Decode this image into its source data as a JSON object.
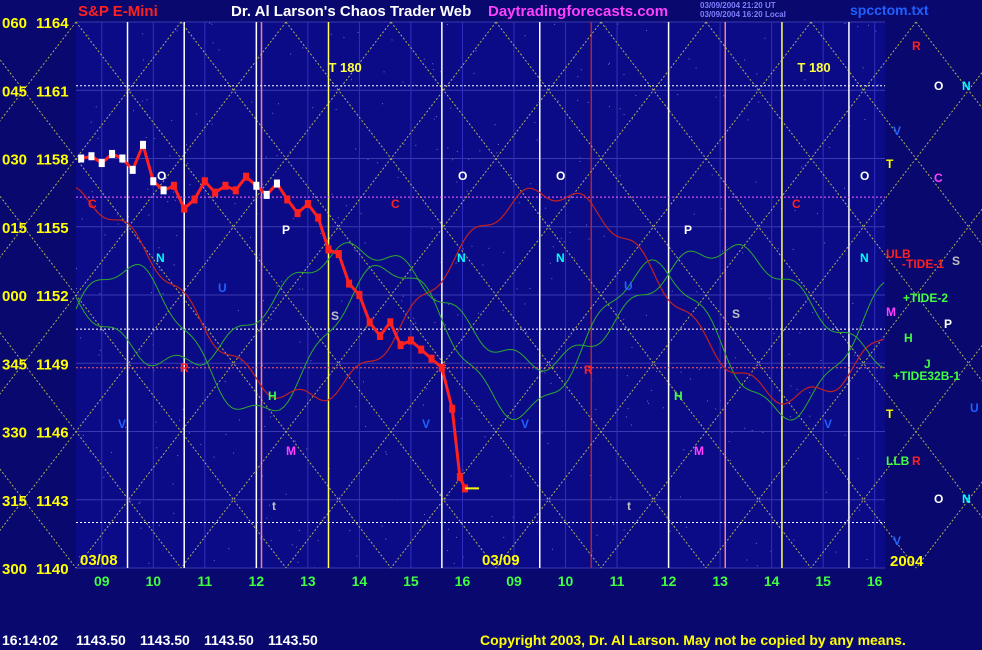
{
  "header": {
    "symbol": "S&P E-Mini",
    "title": "Dr. Al Larson's Chaos Trader Web",
    "site": "Daytradingforecasts.com",
    "stamp1": "03/09/2004 21:20 UT",
    "stamp2": "03/09/2004 16:20 Local",
    "file": "spcctom.txt"
  },
  "status": {
    "time": "16:14:02",
    "quotes": [
      "1143.50",
      "1143.50",
      "1143.50",
      "1143.50"
    ]
  },
  "footer": {
    "copyright": "Copyright 2003, Dr. Al Larson. May not be copied by any means."
  },
  "colors": {
    "background": "#08086e",
    "plot_bg": "#0b0b88",
    "price_red": "#ff2020",
    "price_white": "#ffffff",
    "tide_green": "#2fa82f",
    "tide_red": "#c02020",
    "yellow": "#ffff00",
    "magenta": "#ff40ff",
    "cyan": "#00ffff"
  },
  "chart_data": {
    "type": "line",
    "y_left_labels": [
      "060",
      "045",
      "030",
      "015",
      "000",
      "345",
      "330",
      "315",
      "300"
    ],
    "y_ticks": [
      1164,
      1161,
      1158,
      1155,
      1152,
      1149,
      1146,
      1143,
      1140
    ],
    "ylim": [
      1140,
      1164
    ],
    "x_ticks": [
      "09",
      "10",
      "11",
      "12",
      "13",
      "14",
      "15",
      "16",
      "09",
      "10",
      "11",
      "12",
      "13",
      "14",
      "15",
      "16"
    ],
    "date_labels": [
      "03/08",
      "03/09",
      "2004"
    ],
    "xlim": [
      8.5,
      24.2
    ],
    "grid": true,
    "series": [
      {
        "name": "",
        "color": "#ff2020",
        "x": [
          8.6,
          8.8,
          9.0,
          9.2,
          9.4,
          9.6,
          9.8,
          10.0,
          10.2,
          10.4,
          10.6,
          10.8,
          11.0,
          11.2,
          11.4,
          11.6,
          11.8,
          12.0,
          12.2,
          12.4,
          12.6,
          12.8,
          13.0,
          13.2,
          13.4,
          13.6,
          13.8,
          14.0,
          14.2,
          14.4,
          14.6,
          14.8,
          15.0,
          15.2,
          15.4,
          15.6,
          15.8,
          15.95,
          16.05
        ],
        "values": [
          1158.0,
          1158.1,
          1157.8,
          1158.2,
          1158.0,
          1157.5,
          1158.6,
          1157.0,
          1156.6,
          1156.8,
          1155.8,
          1156.2,
          1157.0,
          1156.5,
          1156.8,
          1156.6,
          1157.2,
          1156.8,
          1156.4,
          1156.9,
          1156.2,
          1155.6,
          1156.0,
          1155.4,
          1154.0,
          1153.8,
          1152.5,
          1152.0,
          1150.8,
          1150.2,
          1150.8,
          1149.8,
          1150.0,
          1149.6,
          1149.2,
          1148.8,
          1147.0,
          1144.0,
          1143.5
        ]
      }
    ],
    "flux_lines": [
      {
        "name": "ULB",
        "color": "#ff2020"
      },
      {
        "name": "-TIDE-1",
        "color": "#ff2020"
      },
      {
        "name": "+TIDE-2",
        "color": "#40ff40"
      },
      {
        "name": "+TIDE32B-1",
        "color": "#40ff40"
      },
      {
        "name": "LLB",
        "color": "#40ff40"
      }
    ],
    "annotations": [
      {
        "text": "T 180",
        "x": 13.4,
        "y": 1161.8
      },
      {
        "text": "T 180",
        "x": 22.5,
        "y": 1161.8
      }
    ]
  },
  "right_legend": {
    "items": [
      {
        "text": "R",
        "color": "#ff2020"
      },
      {
        "text": "O",
        "color": "#ffffff"
      },
      {
        "text": "N",
        "color": "#00ffff"
      },
      {
        "text": "V",
        "color": "#2060ff"
      },
      {
        "text": "T",
        "color": "#ffff00"
      },
      {
        "text": "C",
        "color": "#ff40ff"
      },
      {
        "text": "ULB",
        "color": "#ff2020"
      },
      {
        "text": "-TIDE-1",
        "color": "#ff2020"
      },
      {
        "text": "S",
        "color": "#c0c0c0"
      },
      {
        "text": "+TIDE-2",
        "color": "#40ff40"
      },
      {
        "text": "M",
        "color": "#ff40ff"
      },
      {
        "text": "P",
        "color": "#ffffff"
      },
      {
        "text": "H",
        "color": "#40ff40"
      },
      {
        "text": "J",
        "color": "#40ff40"
      },
      {
        "text": "+TIDE32B-1",
        "color": "#40ff40"
      },
      {
        "text": "T",
        "color": "#ffff00"
      },
      {
        "text": "U",
        "color": "#2060ff"
      },
      {
        "text": "LLB",
        "color": "#40ff40"
      },
      {
        "text": "R",
        "color": "#ff2020"
      },
      {
        "text": "O",
        "color": "#ffffff"
      },
      {
        "text": "N",
        "color": "#00ffff"
      },
      {
        "text": "V",
        "color": "#2060ff"
      }
    ]
  },
  "plot_markers": [
    {
      "text": "O",
      "color": "#ffffff"
    },
    {
      "text": "C",
      "color": "#ff2020"
    },
    {
      "text": "N",
      "color": "#00ffff"
    },
    {
      "text": "P",
      "color": "#ffffff"
    },
    {
      "text": "S",
      "color": "#c0c0c0"
    },
    {
      "text": "H",
      "color": "#40ff40"
    },
    {
      "text": "M",
      "color": "#ff40ff"
    },
    {
      "text": "V",
      "color": "#2060ff"
    },
    {
      "text": "U",
      "color": "#2060ff"
    },
    {
      "text": "R",
      "color": "#ff2020"
    },
    {
      "text": "t",
      "color": "#c0c0c0"
    },
    {
      "text": "C",
      "color": "#ff2020"
    },
    {
      "text": "O",
      "color": "#ffffff"
    },
    {
      "text": "N",
      "color": "#00ffff"
    },
    {
      "text": "V",
      "color": "#2060ff"
    },
    {
      "text": "O",
      "color": "#ffffff"
    },
    {
      "text": "N",
      "color": "#00ffff"
    },
    {
      "text": "V",
      "color": "#2060ff"
    },
    {
      "text": "R",
      "color": "#ff2020"
    },
    {
      "text": "U",
      "color": "#2060ff"
    },
    {
      "text": "t",
      "color": "#c0c0c0"
    },
    {
      "text": "H",
      "color": "#40ff40"
    },
    {
      "text": "P",
      "color": "#ffffff"
    },
    {
      "text": "M",
      "color": "#ff40ff"
    },
    {
      "text": "S",
      "color": "#c0c0c0"
    },
    {
      "text": "C",
      "color": "#ff2020"
    },
    {
      "text": "O",
      "color": "#ffffff"
    },
    {
      "text": "N",
      "color": "#00ffff"
    },
    {
      "text": "V",
      "color": "#2060ff"
    }
  ]
}
